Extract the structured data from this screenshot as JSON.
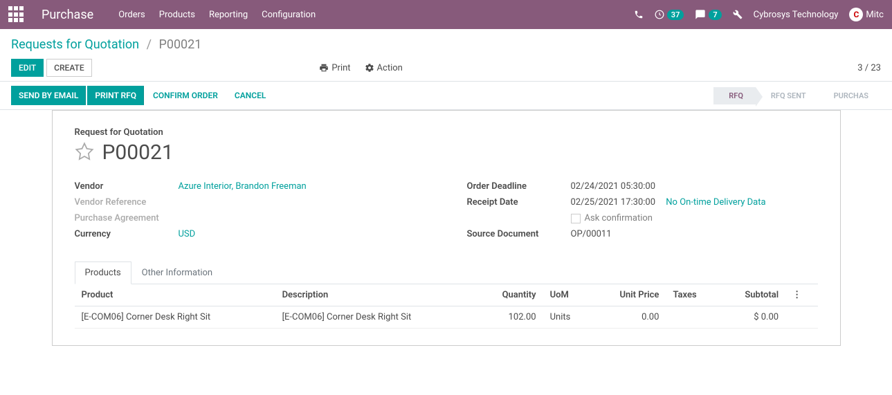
{
  "navbar": {
    "app_title": "Purchase",
    "menu": [
      "Orders",
      "Products",
      "Reporting",
      "Configuration"
    ],
    "activity_badge": "37",
    "discuss_badge": "7",
    "company": "Cybrosys Technology",
    "user": "Mitc"
  },
  "breadcrumb": {
    "parent": "Requests for Quotation",
    "current": "P00021"
  },
  "buttons": {
    "edit": "Edit",
    "create": "Create",
    "print": "Print",
    "action": "Action"
  },
  "pager": "3 / 23",
  "statusbar": {
    "send_email": "Send by Email",
    "print_rfq": "Print RFQ",
    "confirm": "Confirm Order",
    "cancel": "Cancel",
    "steps": [
      "RFQ",
      "RFQ SENT",
      "PURCHAS"
    ]
  },
  "form": {
    "subtitle": "Request for Quotation",
    "title": "P00021",
    "labels": {
      "vendor": "Vendor",
      "vendor_ref": "Vendor Reference",
      "purchase_agreement": "Purchase Agreement",
      "currency": "Currency",
      "order_deadline": "Order Deadline",
      "receipt_date": "Receipt Date",
      "ask_confirmation": "Ask confirmation",
      "source_document": "Source Document"
    },
    "values": {
      "vendor": "Azure Interior, Brandon Freeman",
      "currency": "USD",
      "order_deadline": "02/24/2021 05:30:00",
      "receipt_date": "02/25/2021 17:30:00",
      "source_document": "OP/00011",
      "delivery_info": "No On-time Delivery Data"
    }
  },
  "tabs": {
    "products": "Products",
    "other": "Other Information"
  },
  "table": {
    "headers": {
      "product": "Product",
      "description": "Description",
      "quantity": "Quantity",
      "uom": "UoM",
      "unit_price": "Unit Price",
      "taxes": "Taxes",
      "subtotal": "Subtotal"
    },
    "rows": [
      {
        "product": "[E-COM06] Corner Desk Right Sit",
        "description": "[E-COM06] Corner Desk Right Sit",
        "quantity": "102.00",
        "uom": "Units",
        "unit_price": "0.00",
        "taxes": "",
        "subtotal": "$ 0.00"
      }
    ]
  }
}
